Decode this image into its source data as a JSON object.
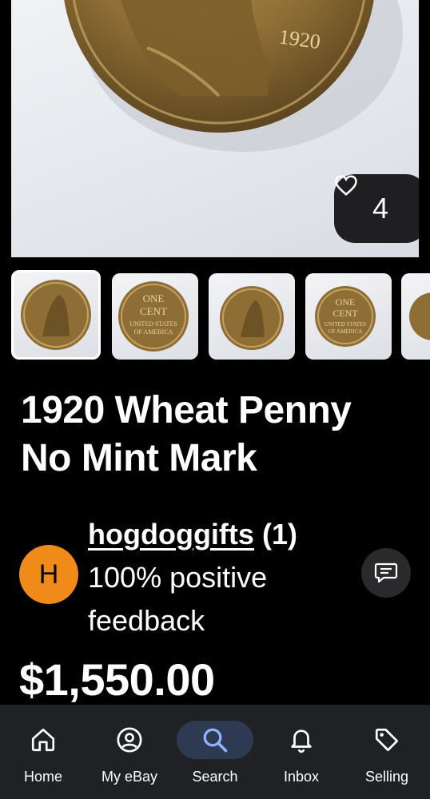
{
  "hero": {
    "coin_date": "1920",
    "like_count": "4",
    "like_icon": "heart-outline-icon"
  },
  "thumbnails": [
    {
      "name": "coin-obverse",
      "selected": true
    },
    {
      "name": "coin-reverse",
      "selected": false
    },
    {
      "name": "coin-obverse",
      "selected": false
    },
    {
      "name": "coin-reverse",
      "selected": false
    },
    {
      "name": "coin-obverse-partial",
      "selected": false
    }
  ],
  "coin_reverse_text": {
    "line1": "ONE",
    "line2": "CENT",
    "line3": "UNITED STATES",
    "line4": "OF AMERICA"
  },
  "listing": {
    "title_line1": "1920 Wheat Penny",
    "title_line2": "No Mint Mark",
    "price": "$1,550.00"
  },
  "seller": {
    "avatar_letter": "H",
    "name": "hogdoggifts",
    "feedback_count": "(1)",
    "feedback_text": "100% positive feedback"
  },
  "nav": {
    "items": [
      {
        "label": "Home",
        "icon": "home-icon"
      },
      {
        "label": "My eBay",
        "icon": "account-icon"
      },
      {
        "label": "Search",
        "icon": "search-icon",
        "active": true
      },
      {
        "label": "Inbox",
        "icon": "bell-icon"
      },
      {
        "label": "Selling",
        "icon": "tag-icon"
      }
    ]
  },
  "colors": {
    "background": "#000000",
    "avatar": "#f08a19",
    "nav_background": "#202124",
    "nav_active": "#2e3a52",
    "coin": "#9a7a3a"
  }
}
